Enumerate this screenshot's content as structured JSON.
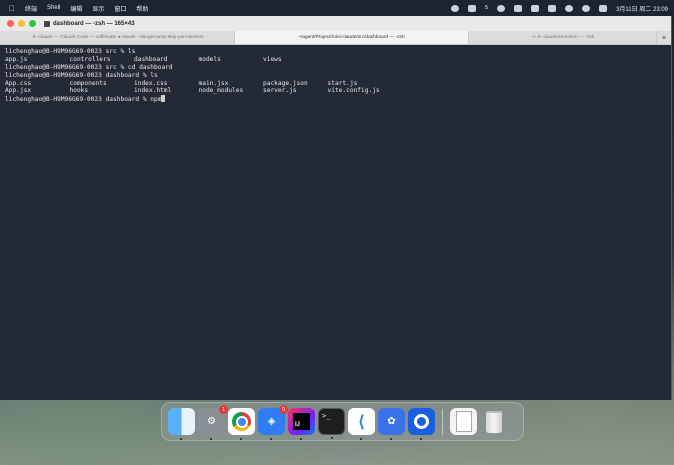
{
  "menubar": {
    "apple": "",
    "items": [
      "终端",
      "Shell",
      "编辑",
      "显示",
      "窗口",
      "帮助"
    ],
    "notification_count": "5",
    "clock": "3月11日 周二 23:09"
  },
  "window": {
    "title": "dashboard — -zsh — 165×43",
    "tabs": [
      "..t/--claude — Claude Code — caffeinate ◂ claude --dangerously-skip-permissions",
      "~/agent/Project/mini-claude/src/dashboard — -zsh",
      "~/..t/--claude/remotion — -zsh"
    ],
    "tab_add": "+"
  },
  "terminal": {
    "lines": [
      "lichenghao@B-H9M96G69-0023 src % ls",
      "lichenghao@B-H9M96G69-0023 src % cd dashboard",
      "lichenghao@B-H9M96G69-0023 dashboard % ls",
      "lichenghao@B-H9M96G69-0023 dashboard % npm"
    ],
    "ls_src_row": [
      "app.js",
      "controllers",
      "dashboard",
      "models",
      "views"
    ],
    "ls_dash_row1": [
      "App.css",
      "components",
      "index.css",
      "main.jsx",
      "package.json",
      "start.js"
    ],
    "ls_dash_row2": [
      "App.jsx",
      "hooks",
      "index.html",
      "node_modules",
      "server.js",
      "vite.config.js"
    ]
  },
  "dock": {
    "apps": [
      {
        "name": "Finder",
        "icon": "finder-icon"
      },
      {
        "name": "System Settings",
        "icon": "settings-icon",
        "badge": "1"
      },
      {
        "name": "Chrome",
        "icon": "chrome-icon"
      },
      {
        "name": "QQ",
        "icon": "qq-icon",
        "badge": "0"
      },
      {
        "name": "IntelliJ IDEA",
        "icon": "intellij-icon"
      },
      {
        "name": "Terminal",
        "icon": "terminal-icon",
        "glyph": ">_"
      },
      {
        "name": "VS Code",
        "icon": "vscode-icon",
        "glyph": "⟨"
      },
      {
        "name": "Paw",
        "icon": "paw-icon"
      },
      {
        "name": "Quark",
        "icon": "quark-icon"
      },
      {
        "name": "File",
        "icon": "file-icon"
      },
      {
        "name": "Trash",
        "icon": "trash-icon"
      }
    ]
  }
}
